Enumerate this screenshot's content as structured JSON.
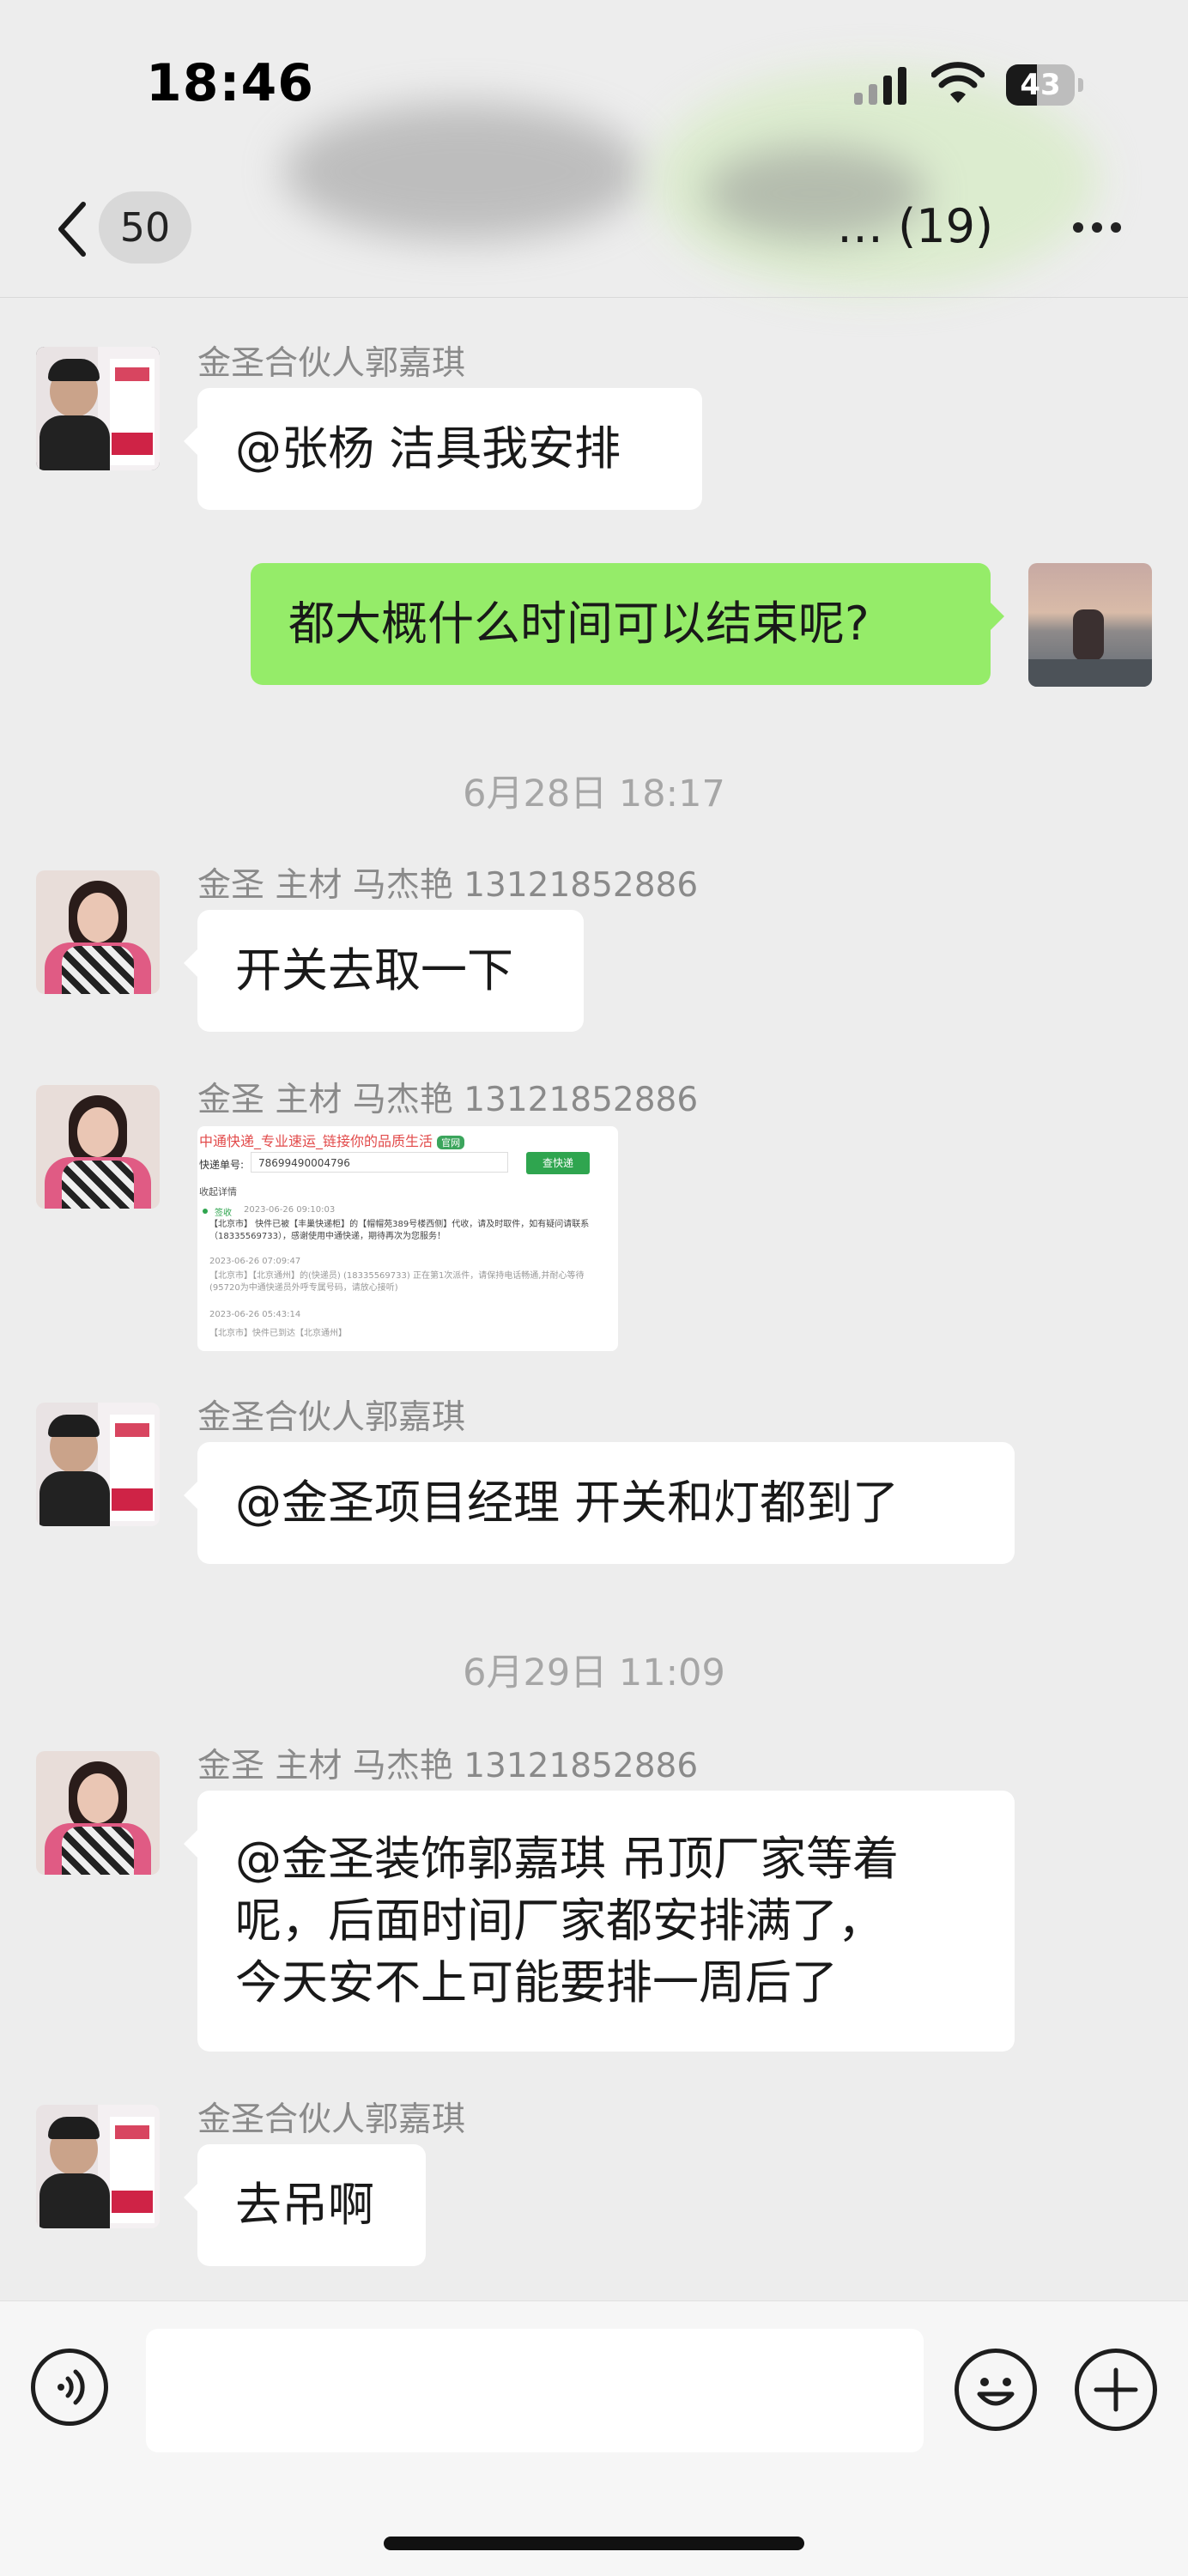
{
  "status": {
    "time": "18:46",
    "battery": "43"
  },
  "nav": {
    "unread_count": "50",
    "title_suffix": "… (19)"
  },
  "messages": [
    {
      "sender": "金圣合伙人郭嘉琪",
      "text": "@张杨 洁具我安排"
    },
    {
      "text": "都大概什么时间可以结束呢?"
    },
    {
      "timestamp": "6月28日 18:17"
    },
    {
      "sender": "金圣 主材 马杰艳 13121852886",
      "text": "开关去取一下"
    },
    {
      "sender": "金圣 主材 马杰艳 13121852886",
      "image": {
        "header": "中通快递_专业速运_链接你的品质生活",
        "badge": "官网",
        "label": "快递单号:",
        "tracking_no": "78699490004796",
        "button": "查快递",
        "expand": "收起详情",
        "events": [
          {
            "status": "签收",
            "time": "2023-06-26 09:10:03",
            "text": "【北京市】 快件已被【丰巢快递柜】的【帽帽苑389号楼西侧】代收，请及时取件，如有疑问请联系（18335569733），感谢使用中通快递，期待再次为您服务！"
          },
          {
            "time": "2023-06-26 07:09:47",
            "text": "【北京市】【北京通州】的(快递员) (18335569733) 正在第1次派件，请保持电话畅通,并耐心等待 (95720为中通快递员外呼专属号码，请放心接听)"
          },
          {
            "time": "2023-06-26 05:43:14",
            "text": "【北京市】快件已到达【北京通州】"
          }
        ]
      }
    },
    {
      "sender": "金圣合伙人郭嘉琪",
      "text": "@金圣项目经理 开关和灯都到了"
    },
    {
      "timestamp": "6月29日 11:09"
    },
    {
      "sender": "金圣 主材 马杰艳 13121852886",
      "lines": [
        "@金圣装饰郭嘉琪 吊顶厂家等着",
        "呢，后面时间厂家都安排满了，",
        "今天安不上可能要排一周后了"
      ]
    },
    {
      "sender": "金圣合伙人郭嘉琪",
      "text": "去吊啊"
    }
  ],
  "input": {
    "placeholder": ""
  }
}
